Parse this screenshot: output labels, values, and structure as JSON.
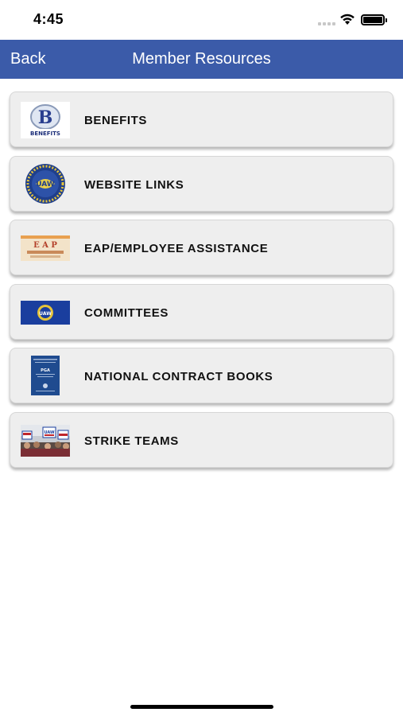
{
  "status_bar": {
    "time": "4:45"
  },
  "nav": {
    "back_label": "Back",
    "title": "Member Resources",
    "bar_color": "#3b5ba9"
  },
  "items": [
    {
      "label": "BENEFITS",
      "icon": "benefits-logo"
    },
    {
      "label": "WEBSITE LINKS",
      "icon": "uaw-seal"
    },
    {
      "label": "EAP/EMPLOYEE ASSISTANCE",
      "icon": "eap-banner"
    },
    {
      "label": "COMMITTEES",
      "icon": "uaw-flag"
    },
    {
      "label": "NATIONAL CONTRACT BOOKS",
      "icon": "contract-book"
    },
    {
      "label": "STRIKE TEAMS",
      "icon": "strike-photo"
    }
  ],
  "thumb_text": {
    "benefits_big": "B",
    "benefits_small": "BENEFITS",
    "uaw": "UAW",
    "eap": "E A P",
    "book": "PGA"
  }
}
